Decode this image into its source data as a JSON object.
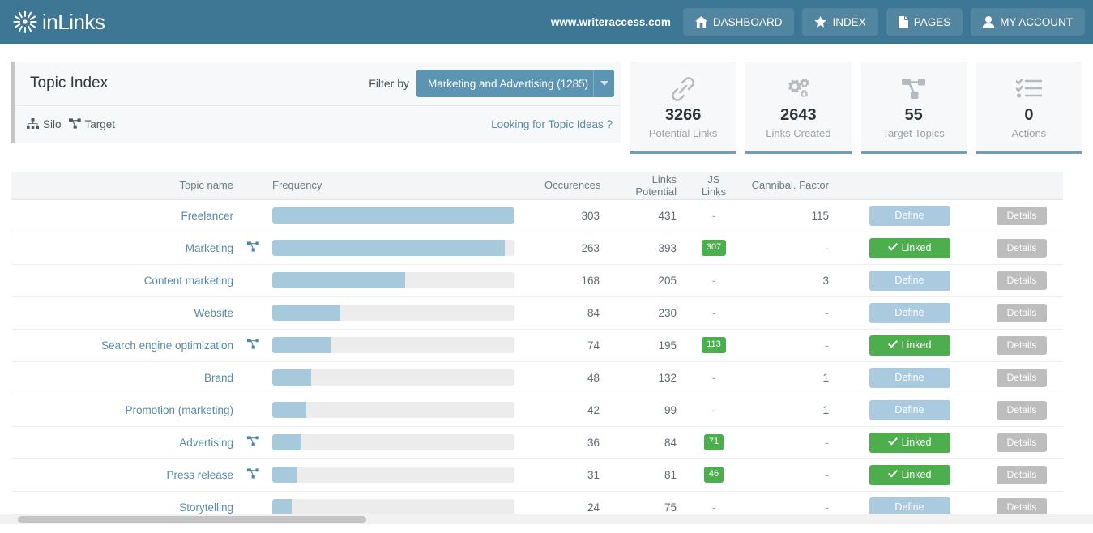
{
  "brand": {
    "name": "inLinks",
    "logo_icon": "sunburst-icon"
  },
  "topnav": {
    "site_url": "www.writeraccess.com",
    "items": [
      {
        "label": "DASHBOARD",
        "icon": "home-icon"
      },
      {
        "label": "INDEX",
        "icon": "star-icon"
      },
      {
        "label": "PAGES",
        "icon": "file-icon"
      },
      {
        "label": "MY ACCOUNT",
        "icon": "user-icon"
      }
    ]
  },
  "panel": {
    "title": "Topic Index",
    "filter_label": "Filter by",
    "filter_value": "Marketing and Advertising (1285)",
    "caret_icon": "chevron-down-icon",
    "silo": {
      "label": "Silo",
      "icon": "sitemap-icon"
    },
    "target": {
      "label": "Target",
      "icon": "project-diagram-icon"
    },
    "topic_ideas_link": "Looking for Topic Ideas ?"
  },
  "stats": [
    {
      "value": "3266",
      "label": "Potential Links",
      "icon": "link-icon"
    },
    {
      "value": "2643",
      "label": "Links Created",
      "icon": "cogs-icon"
    },
    {
      "value": "55",
      "label": "Target Topics",
      "icon": "project-diagram-icon"
    },
    {
      "value": "0",
      "label": "Actions",
      "icon": "tasks-icon"
    }
  ],
  "table": {
    "columns": [
      "Topic name",
      "Frequency",
      "Occurences",
      "Links Potential",
      "JS Links",
      "Cannibal. Factor"
    ],
    "rows": [
      {
        "name": "Freelancer",
        "target_icon": false,
        "freq_pct": 100,
        "occurences": "303",
        "links_potential": "431",
        "js_links": "-",
        "cannibal": "115",
        "action": "Define",
        "action_type": "define",
        "details": "Details"
      },
      {
        "name": "Marketing",
        "target_icon": true,
        "freq_pct": 96,
        "occurences": "263",
        "links_potential": "393",
        "js_links": "307",
        "cannibal": "-",
        "action": "Linked",
        "action_type": "linked",
        "details": "Details"
      },
      {
        "name": "Content marketing",
        "target_icon": false,
        "freq_pct": 55,
        "occurences": "168",
        "links_potential": "205",
        "js_links": "-",
        "cannibal": "3",
        "action": "Define",
        "action_type": "define",
        "details": "Details"
      },
      {
        "name": "Website",
        "target_icon": false,
        "freq_pct": 28,
        "occurences": "84",
        "links_potential": "230",
        "js_links": "-",
        "cannibal": "-",
        "action": "Define",
        "action_type": "define",
        "details": "Details"
      },
      {
        "name": "Search engine optimization",
        "target_icon": true,
        "freq_pct": 24,
        "occurences": "74",
        "links_potential": "195",
        "js_links": "113",
        "cannibal": "-",
        "action": "Linked",
        "action_type": "linked",
        "details": "Details"
      },
      {
        "name": "Brand",
        "target_icon": false,
        "freq_pct": 16,
        "occurences": "48",
        "links_potential": "132",
        "js_links": "-",
        "cannibal": "1",
        "action": "Define",
        "action_type": "define",
        "details": "Details"
      },
      {
        "name": "Promotion (marketing)",
        "target_icon": false,
        "freq_pct": 14,
        "occurences": "42",
        "links_potential": "99",
        "js_links": "-",
        "cannibal": "1",
        "action": "Define",
        "action_type": "define",
        "details": "Details"
      },
      {
        "name": "Advertising",
        "target_icon": true,
        "freq_pct": 12,
        "occurences": "36",
        "links_potential": "84",
        "js_links": "71",
        "cannibal": "-",
        "action": "Linked",
        "action_type": "linked",
        "details": "Details"
      },
      {
        "name": "Press release",
        "target_icon": true,
        "freq_pct": 10,
        "occurences": "31",
        "links_potential": "81",
        "js_links": "46",
        "cannibal": "-",
        "action": "Linked",
        "action_type": "linked",
        "details": "Details"
      },
      {
        "name": "Storytelling",
        "target_icon": false,
        "freq_pct": 8,
        "occurences": "24",
        "links_potential": "75",
        "js_links": "-",
        "cannibal": "-",
        "action": "Define",
        "action_type": "define",
        "details": "Details"
      }
    ]
  },
  "colors": {
    "header_bg": "#3d7794",
    "accent_blue": "#5b95b1",
    "bar_fill": "#a6c9dc",
    "badge_green": "#4cae4c",
    "define_blue": "#a9cadf",
    "details_gray": "#bdbdbd"
  }
}
